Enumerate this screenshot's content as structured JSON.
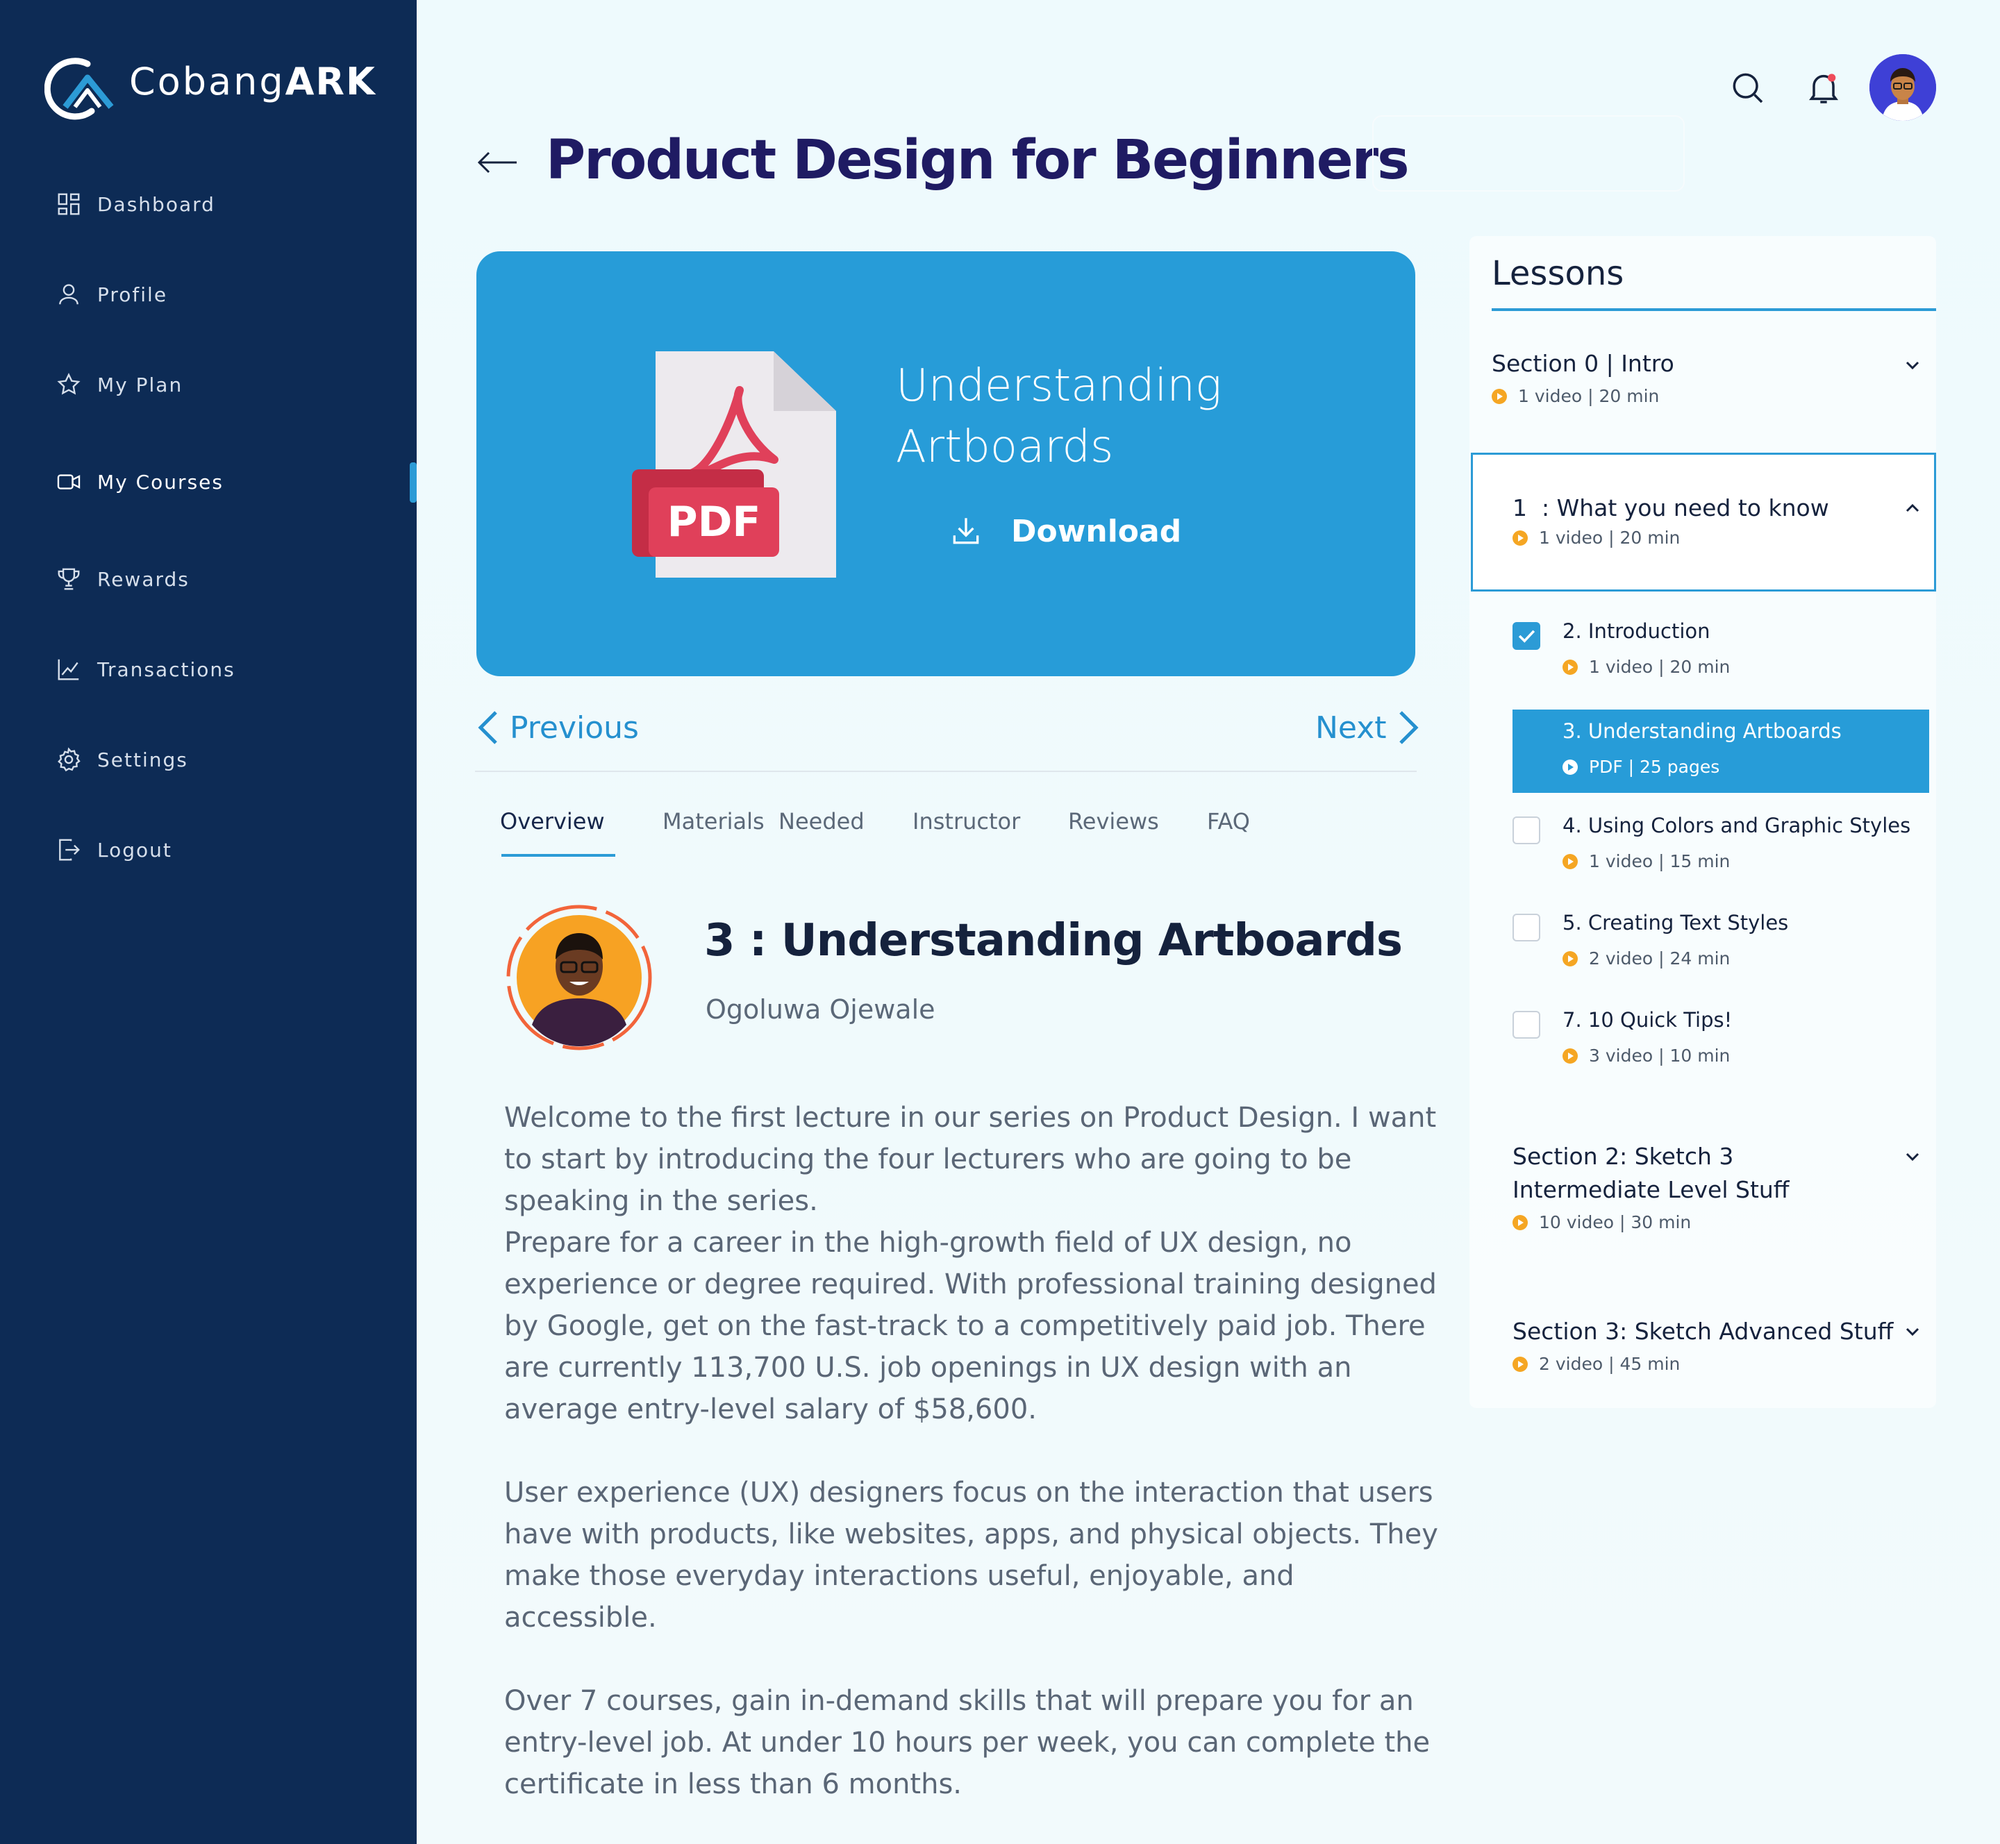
{
  "brand": {
    "name_light": "Cobang",
    "name_bold": "ARK"
  },
  "sidebar": {
    "items": [
      {
        "label": "Dashboard",
        "icon": "dashboard-icon"
      },
      {
        "label": "Profile",
        "icon": "user-icon"
      },
      {
        "label": "My Plan",
        "icon": "star-icon"
      },
      {
        "label": "My Courses",
        "icon": "video-icon"
      },
      {
        "label": "Rewards",
        "icon": "trophy-icon"
      },
      {
        "label": "Transactions",
        "icon": "chart-icon"
      },
      {
        "label": "Settings",
        "icon": "gear-icon"
      },
      {
        "label": "Logout",
        "icon": "logout-icon"
      }
    ],
    "active_item": "My Courses"
  },
  "header": {
    "icons": [
      "search-icon",
      "bell-icon",
      "avatar"
    ]
  },
  "page": {
    "title": "Product Design for Beginners"
  },
  "material": {
    "title": "Understanding Artboards",
    "file_badge": "PDF",
    "download_label": "Download"
  },
  "pager": {
    "previous": "Previous",
    "next": "Next"
  },
  "tabs": [
    {
      "label": "Overview",
      "active": true
    },
    {
      "label": "Materials  Needed",
      "active": false
    },
    {
      "label": "Instructor",
      "active": false
    },
    {
      "label": "Reviews",
      "active": false
    },
    {
      "label": "FAQ",
      "active": false
    }
  ],
  "lecture": {
    "title": "3 : Understanding Artboards",
    "instructor": "Ogoluwa Ojewale",
    "paragraphs": [
      "Welcome to the first lecture in our series on Product Design. I want to start by introducing the four lecturers who are going to be speaking in the series.",
      "Prepare for a career in the high-growth field of UX design, no experience or degree required. With professional training designed by Google, get on the fast-track to a competitively paid job. There are currently 113,700 U.S. job openings in UX design with an average entry-level salary of $58,600.",
      "User experience (UX) designers focus on the interaction that users have with products, like websites, apps, and physical objects. They make those everyday interactions useful, enjoyable, and accessible.",
      "Over 7 courses, gain in-demand skills that will prepare you for an entry-level job. At under 10 hours per week, you can complete the certificate in less than 6 months."
    ]
  },
  "lessons": {
    "title": "Lessons",
    "sections": [
      {
        "title": "Section 0 | Intro",
        "meta": "1 video | 20 min",
        "expanded": false
      },
      {
        "title": "1  : What you need to know",
        "meta": "1 video | 20 min",
        "expanded": true
      },
      {
        "title": "Section 2: Sketch 3",
        "title_line2": "Intermediate Level Stuff",
        "meta": "10 video | 30 min",
        "expanded": false
      },
      {
        "title": "Section 3: Sketch Advanced Stuff",
        "meta": "2 video | 45 min",
        "expanded": false
      }
    ],
    "items": [
      {
        "title": "2. Introduction",
        "meta": "1 video | 20 min",
        "checked": true
      },
      {
        "title": "3. Understanding Artboards",
        "meta": "PDF | 25 pages",
        "current": true
      },
      {
        "title": "4. Using Colors and Graphic Styles",
        "meta": "1 video | 15 min",
        "checked": false
      },
      {
        "title": "5. Creating Text Styles",
        "meta": "2 video | 24 min",
        "checked": false
      },
      {
        "title": "7. 10 Quick Tips!",
        "meta": "3 video | 10 min",
        "checked": false
      }
    ]
  },
  "colors": {
    "sidebar_bg": "#0d2b55",
    "accent": "#279cd8",
    "title": "#1f1b63",
    "meta_dot": "#f5a623",
    "pdf_red": "#e0405a"
  }
}
